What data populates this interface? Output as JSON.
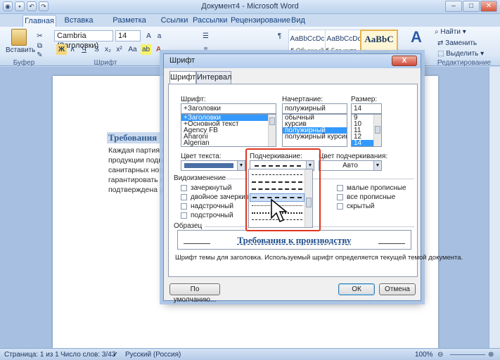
{
  "window": {
    "title": "Документ4 - Microsoft Word"
  },
  "ribbon_tabs": [
    "Главная",
    "Вставка",
    "Разметка страницы",
    "Ссылки",
    "Рассылки",
    "Рецензирование",
    "Вид"
  ],
  "clipboard": {
    "paste_label": "Вставить",
    "group_label": "Буфер обмена"
  },
  "font_group": {
    "font_name": "Cambria (Заголовки)",
    "font_size": "14",
    "group_label": "Шрифт",
    "bold": "Ж",
    "italic": "К",
    "underline": "Ч"
  },
  "styles": [
    {
      "sample": "AaBbCcDc",
      "caption": "¶ Обычный"
    },
    {
      "sample": "AaBbCcDc",
      "caption": "¶ Без инте..."
    },
    {
      "sample": "AaBbC",
      "caption": "Заголово..."
    }
  ],
  "editing": {
    "find": "Найти",
    "replace": "Заменить",
    "select": "Выделить",
    "group_label": "Редактирование"
  },
  "document": {
    "heading": "Требования",
    "lines": [
      "Каждая партия вы",
      "продукции подве",
      "санитарных норм",
      "гарантировать по",
      "подтверждена ро"
    ]
  },
  "status_bar": {
    "page": "Страница: 1 из 1",
    "words": "Число слов: 3/43",
    "language": "Русский (Россия)",
    "zoom": "100%"
  },
  "dialog": {
    "title": "Шрифт",
    "close": "X",
    "tabs": [
      "Шрифт",
      "Интервал"
    ],
    "font_label": "Шрифт:",
    "font_value": "+Заголовки",
    "font_list": [
      "+Заголовки",
      "+Основной текст",
      "Agency FB",
      "Aharoni",
      "Algerian"
    ],
    "style_label": "Начертание:",
    "style_value": "полужирный",
    "style_list": [
      "обычный",
      "курсив",
      "полужирный",
      "полужирный курсив"
    ],
    "size_label": "Размер:",
    "size_value": "14",
    "size_list": [
      "9",
      "10",
      "11",
      "12",
      "14"
    ],
    "color_label": "Цвет текста:",
    "underline_label": "Подчеркивание:",
    "underline_color_label": "Цвет подчеркивания:",
    "underline_color_value": "Авто",
    "effects_label": "Видоизменение",
    "effects_left": [
      "зачеркнутый",
      "двойное зачеркивание",
      "надстрочный",
      "подстрочный"
    ],
    "effects_right": [
      "малые прописные",
      "все прописные",
      "скрытый"
    ],
    "preview_label": "Образец",
    "preview_text": "Требования к производству",
    "description": "Шрифт темы для заголовка. Используемый шрифт определяется текущей темой документа.",
    "default_button": "По умолчанию...",
    "ok_button": "ОК",
    "cancel_button": "Отмена"
  },
  "colors": {
    "accent_red": "#e1341e",
    "selection": "#3399ff",
    "heading_blue": "#365f91"
  }
}
